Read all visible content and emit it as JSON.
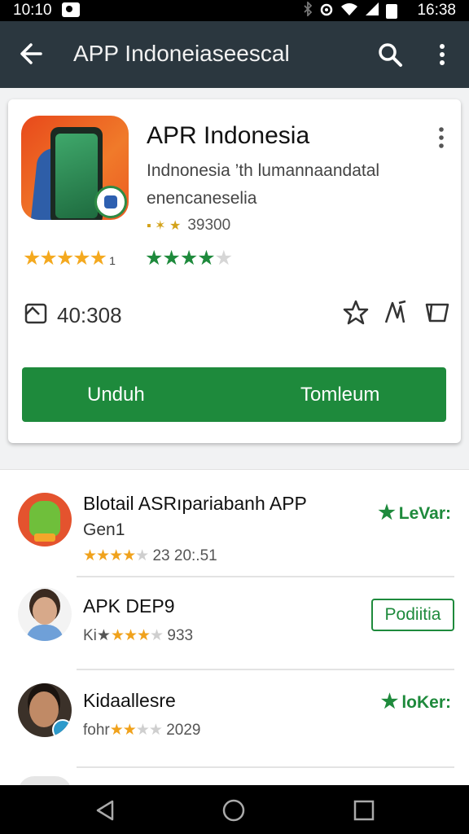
{
  "status_bar": {
    "time_left": "10:10",
    "time_right": "16:38"
  },
  "app_bar": {
    "title": "APP Indoneiaseescal"
  },
  "app_card": {
    "name": "APR Indonesia",
    "description_line1": "Indnonesia ’th lumannaandatal",
    "description_line2": "enencaneselia",
    "meta_icons": "▪ ✶ ★",
    "meta_count": "39300",
    "stars_left": "★★★★★",
    "stars_left_suffix": "1",
    "stars_right_full": "★★★★",
    "stars_right_empty": "★",
    "count_value": "40:308",
    "primary_button_left": "Unduh",
    "primary_button_right": "Tomleum"
  },
  "list": [
    {
      "name": "Blotail ASRıpariabanh APP",
      "subtitle": "Gen1",
      "stars": "★★★★",
      "stars_empty": "★",
      "rating_value": "23 20:.51",
      "tag": "LeVar:"
    },
    {
      "name": "APK DEP9",
      "rating_prefix": "Ki★",
      "stars": "★★★",
      "stars_empty": "★",
      "rating_value": "933",
      "button_label": "Podiitia"
    },
    {
      "name": "Kidaallesre",
      "rating_prefix": "fohr",
      "stars": "★★",
      "stars_empty": "★★",
      "rating_value": "2029",
      "tag": "loKer:"
    }
  ],
  "colors": {
    "appbar": "#2b373f",
    "accent_green": "#1e8a3c",
    "star_gold": "#f4a91f"
  }
}
